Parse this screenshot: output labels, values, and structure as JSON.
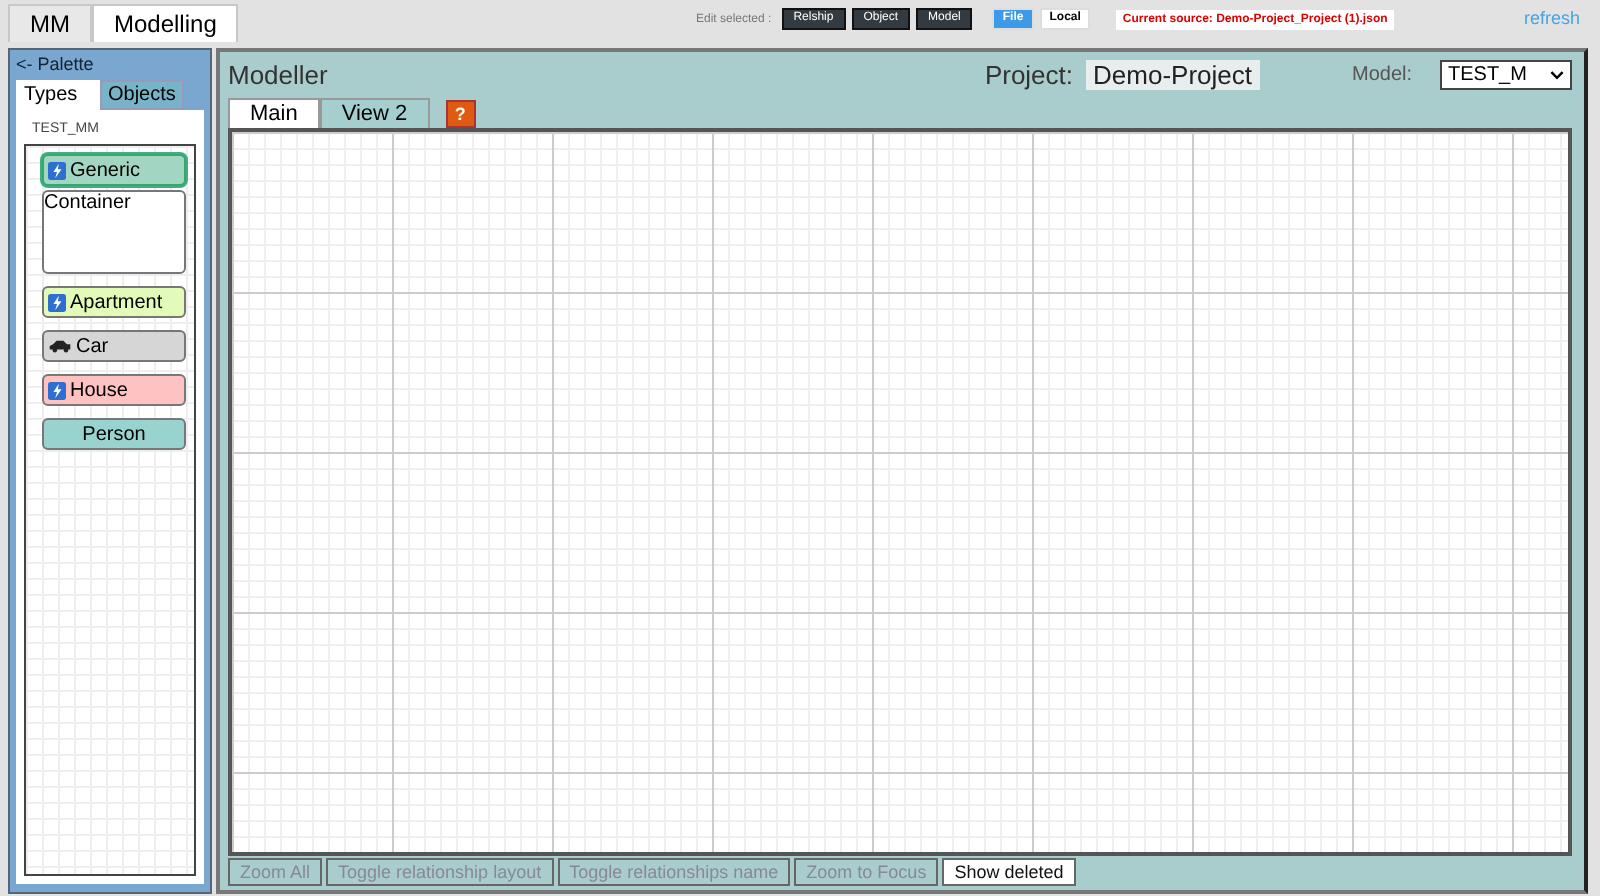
{
  "top_tabs": [
    {
      "label": "MM",
      "selected": false
    },
    {
      "label": "Modelling",
      "selected": true
    }
  ],
  "toolbar": {
    "edit_label": "Edit selected :",
    "edit_buttons": [
      "Relship",
      "Object",
      "Model"
    ],
    "source_buttons": [
      {
        "label": "File",
        "selected": true
      },
      {
        "label": "Local",
        "selected": false
      }
    ],
    "current_source": "Current source: Demo-Project_Project (1).json",
    "refresh": "refresh"
  },
  "palette": {
    "toggle": "<- Palette",
    "tabs": [
      {
        "label": "Types",
        "selected": true
      },
      {
        "label": "Objects",
        "selected": false
      }
    ],
    "metamodel": "TEST_MM",
    "nodes": [
      {
        "kind": "bolt",
        "label": "Generic",
        "color": "#a3d5c3",
        "selected": true
      },
      {
        "kind": "group",
        "label": "Container",
        "color": "#ffffff",
        "selected": false
      },
      {
        "kind": "bolt",
        "label": "Apartment",
        "color": "#e2fbb8",
        "selected": false
      },
      {
        "kind": "car",
        "label": "Car",
        "color": "#d6d6d6",
        "selected": false
      },
      {
        "kind": "bolt",
        "label": "House",
        "color": "#ffc2c2",
        "selected": false
      },
      {
        "kind": "plain",
        "label": "Person",
        "color": "#99d3cf",
        "selected": false
      }
    ]
  },
  "modeller": {
    "title": "Modeller",
    "project_label": "Project:",
    "project_name": "Demo-Project",
    "model_label": "Model:",
    "model_value": "TEST_M",
    "tabs": [
      {
        "label": "Main",
        "selected": true
      },
      {
        "label": "View 2",
        "selected": false
      }
    ],
    "help": "?",
    "buttons": [
      {
        "label": "Zoom All",
        "disabled": true
      },
      {
        "label": "Toggle relationship layout",
        "disabled": true
      },
      {
        "label": "Toggle relationships name",
        "disabled": true
      },
      {
        "label": "Zoom to Focus",
        "disabled": true
      },
      {
        "label": "Show deleted",
        "disabled": false
      }
    ]
  }
}
